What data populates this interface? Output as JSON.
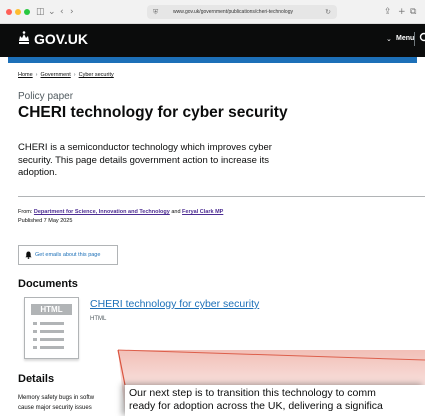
{
  "browser": {
    "url": "www.gov.uk/government/publications/cheri-technology-fo"
  },
  "header": {
    "logo": "GOV.UK",
    "menu": "Menu"
  },
  "breadcrumbs": [
    "Home",
    "Government",
    "Cyber security"
  ],
  "caption": "Policy paper",
  "title": "CHERI technology for cyber security",
  "lede": "CHERI is a semiconductor technology which improves cyber security. This page details government action to increase its adoption.",
  "metadata": {
    "from_label": "From:",
    "org1": "Department for Science, Innovation and Technology",
    "and": "and",
    "org2": "Feryal Clark MP",
    "published": "Published 7 May 2025"
  },
  "subscribe_label": "Get emails about this page",
  "documents": {
    "heading": "Documents",
    "thumb_badge": "HTML",
    "link": "CHERI technology for cyber security",
    "type": "HTML"
  },
  "details": {
    "heading": "Details",
    "line1": "Memory safety bugs in softw",
    "line2": "cause major security issues"
  },
  "callout": {
    "line1": "Our next step is to transition this technology to comm",
    "line2": "ready for adoption across the UK, delivering a significa"
  },
  "colors": {
    "header_bg": "#0b0c0c",
    "stripe": "#1d70b8",
    "link": "#1d70b8",
    "visited_link": "#4c2c92"
  }
}
